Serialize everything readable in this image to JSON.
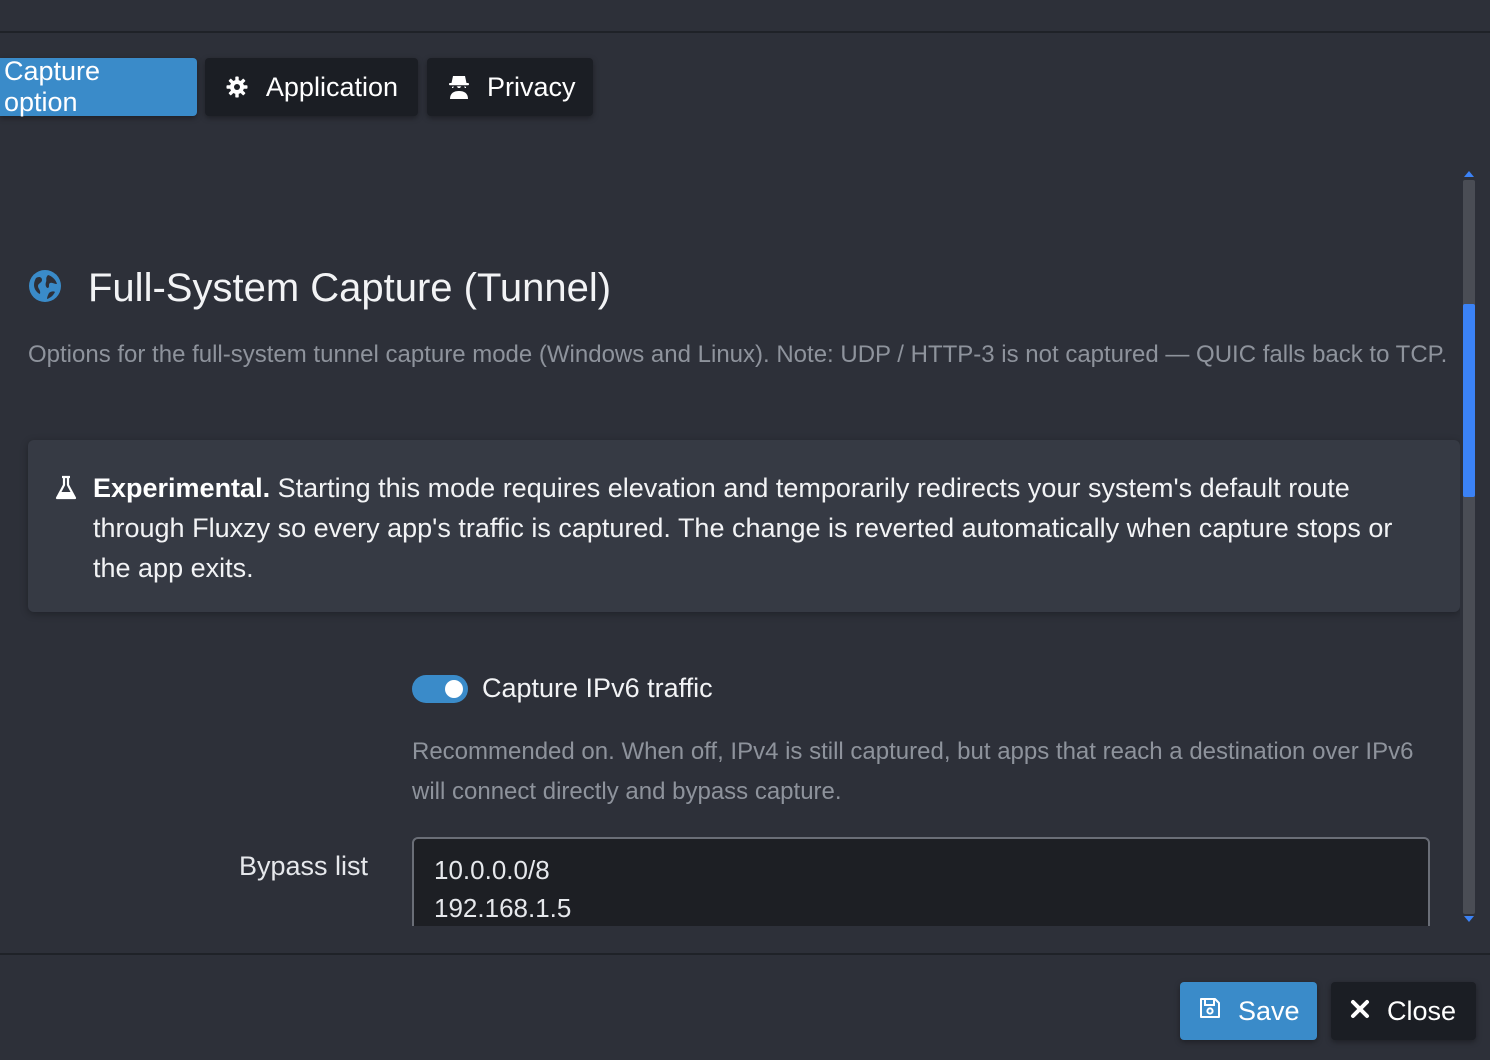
{
  "tabs": [
    {
      "label": "Capture option",
      "icon": "none",
      "active": true
    },
    {
      "label": "Application",
      "icon": "gear-icon",
      "active": false
    },
    {
      "label": "Privacy",
      "icon": "incognito-icon",
      "active": false
    }
  ],
  "section": {
    "icon": "globe-icon",
    "title": "Full-System Capture (Tunnel)",
    "description": "Options for the full-system tunnel capture mode (Windows and Linux). Note: UDP / HTTP-3 is not captured — QUIC falls back to TCP."
  },
  "alert": {
    "icon": "flask-icon",
    "strong": "Experimental.",
    "text": " Starting this mode requires elevation and temporarily redirects your system's default route through Fluxzy so every app's traffic is captured. The change is reverted automatically when capture stops or the app exits."
  },
  "ipv6": {
    "label": "Capture IPv6 traffic",
    "enabled": true,
    "help": "Recommended on. When off, IPv4 is still captured, but apps that reach a destination over IPv6 will connect directly and bypass capture."
  },
  "bypass": {
    "label": "Bypass list",
    "lines": [
      "10.0.0.0/8",
      "192.168.1.5"
    ]
  },
  "footer": {
    "save_label": "Save",
    "close_label": "Close"
  },
  "colors": {
    "accent": "#3a8bc9",
    "background": "#2d3039",
    "scroll_thumb": "#3b82f6"
  }
}
